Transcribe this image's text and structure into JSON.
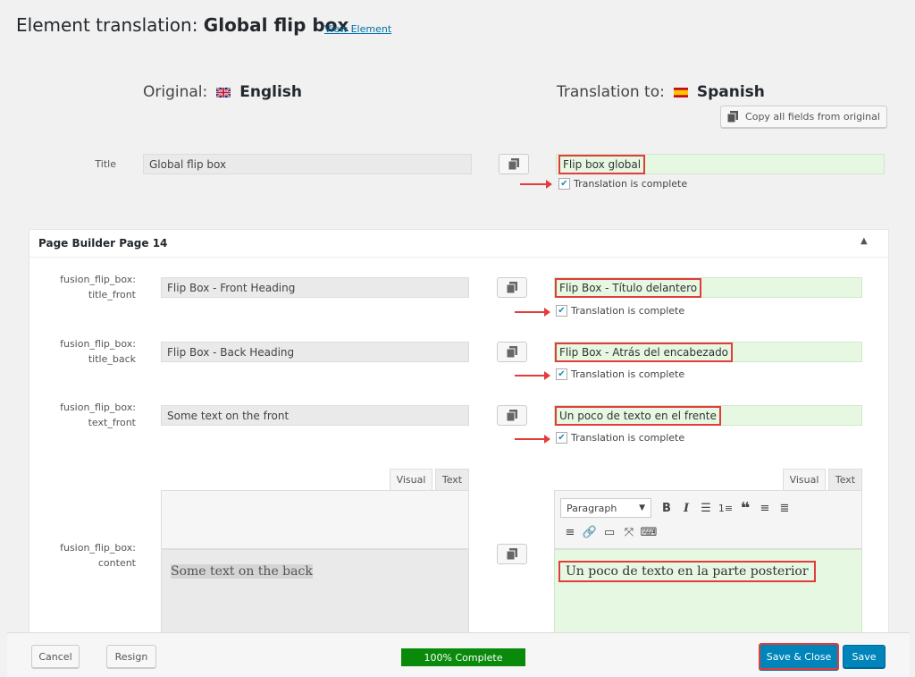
{
  "header": {
    "title_prefix": "Element translation:",
    "title_element": "Global flip box",
    "view_link": "View Element"
  },
  "original": {
    "label": "Original:",
    "language": "English"
  },
  "translation": {
    "label": "Translation to:",
    "language": "Spanish"
  },
  "copy_all_label": "Copy all fields from original",
  "complete_label": "Translation is complete",
  "title_field": {
    "label": "Title",
    "original": "Global flip box",
    "translated": "Flip box global"
  },
  "panel": {
    "title": "Page Builder Page 14"
  },
  "fields": [
    {
      "label": "fusion_flip_box: title_front",
      "original": "Flip Box - Front Heading",
      "translated": "Flip Box - Título delantero"
    },
    {
      "label": "fusion_flip_box: title_back",
      "original": "Flip Box - Back Heading",
      "translated": "Flip Box - Atrás del encabezado"
    },
    {
      "label": "fusion_flip_box: text_front",
      "original": "Some text on the front",
      "translated": "Un poco de texto en el frente"
    }
  ],
  "content_field": {
    "label": "fusion_flip_box: content",
    "original": "Some text on the back",
    "translated": "Un poco de texto en la parte posterior"
  },
  "editor": {
    "tab_visual": "Visual",
    "tab_text": "Text",
    "format": "Paragraph"
  },
  "footer": {
    "cancel": "Cancel",
    "resign": "Resign",
    "progress": "100% Complete",
    "progress_value": 100,
    "save_close": "Save & Close",
    "save": "Save"
  },
  "colors": {
    "accent": "#0085ba",
    "highlight": "#e23c3c",
    "translated_bg": "#e6f7e2",
    "progress": "#0a8a0a"
  }
}
